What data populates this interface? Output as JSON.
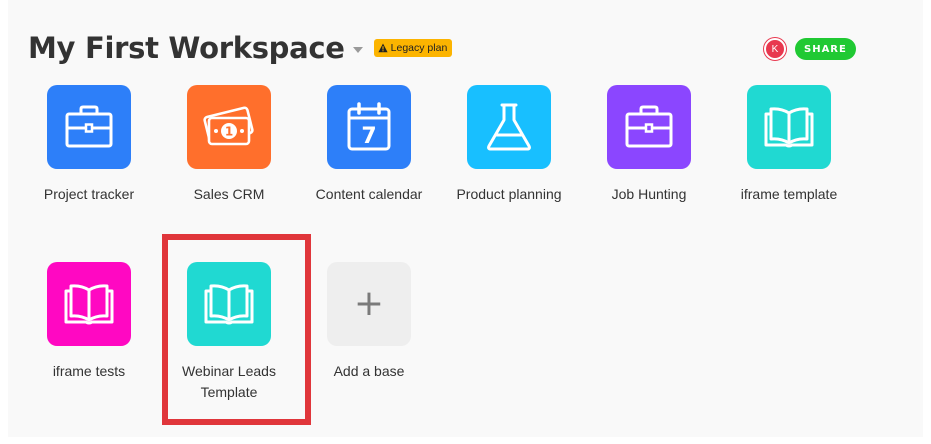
{
  "workspace": {
    "title": "My First Workspace",
    "legacy_badge": "Legacy plan"
  },
  "collaborator": {
    "avatar_initial": "K",
    "avatar_color": "#e8384f"
  },
  "share_label": "SHARE",
  "bases": [
    {
      "label": "Project tracker",
      "color": "#2d7ff9",
      "icon": "briefcase-icon"
    },
    {
      "label": "Sales CRM",
      "color": "#ff6f2c",
      "icon": "money-icon"
    },
    {
      "label": "Content calendar",
      "color": "#2d7ff9",
      "icon": "calendar-icon"
    },
    {
      "label": "Product planning",
      "color": "#18bfff",
      "icon": "flask-icon"
    },
    {
      "label": "Job Hunting",
      "color": "#8b46ff",
      "icon": "briefcase-icon"
    },
    {
      "label": "iframe template",
      "color": "#20d9d2",
      "icon": "book-icon"
    },
    {
      "label": "iframe tests",
      "color": "#ff08c2",
      "icon": "book-icon"
    },
    {
      "label_lines": [
        "Webinar Leads",
        "Template"
      ],
      "color": "#20d9d2",
      "icon": "book-icon"
    }
  ],
  "add_base_label": "Add a base",
  "calendar_day": "7",
  "colors": {
    "accent_share": "#20c933",
    "legacy_badge": "#fcb400",
    "highlight_box": "#e0363b"
  }
}
